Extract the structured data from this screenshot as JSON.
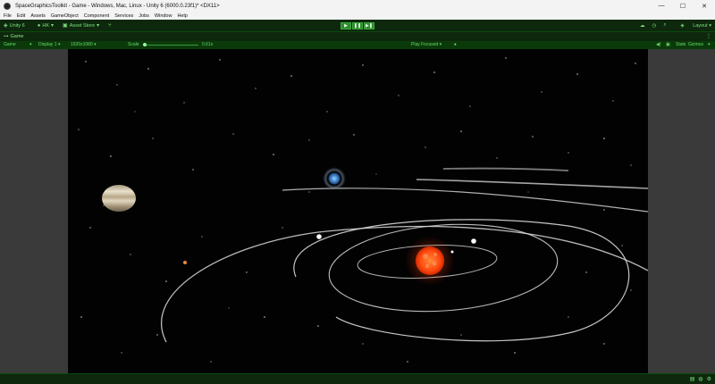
{
  "window": {
    "title": "SpaceGraphicsToolkit - Game - Windows, Mac, Linux - Unity 6 (6000.0.23f1)* <DX11>",
    "controls": [
      "—",
      "☐",
      "✕"
    ]
  },
  "menu": [
    "File",
    "Edit",
    "Assets",
    "GameObject",
    "Component",
    "Services",
    "Jobs",
    "Window",
    "Help"
  ],
  "toolbar": {
    "account": "Unity 6",
    "user": "HK",
    "asset_store": "Asset Store",
    "layout": "Layout"
  },
  "tab": {
    "label": "Game"
  },
  "game_bar": {
    "mode": "Game",
    "display": "Display 1",
    "resolution": "1920x1080",
    "scale_label": "Scale",
    "scale_value": "0.61x",
    "play_mode": "Play Focused",
    "stats": "Stats",
    "gizmos": "Gizmos"
  },
  "colors": {
    "toolbar_bg": "#0d280d",
    "accent": "#7de07d",
    "play_button": "#2d8a2d",
    "space_bg": "#020203",
    "sun": "#ff5a12"
  }
}
